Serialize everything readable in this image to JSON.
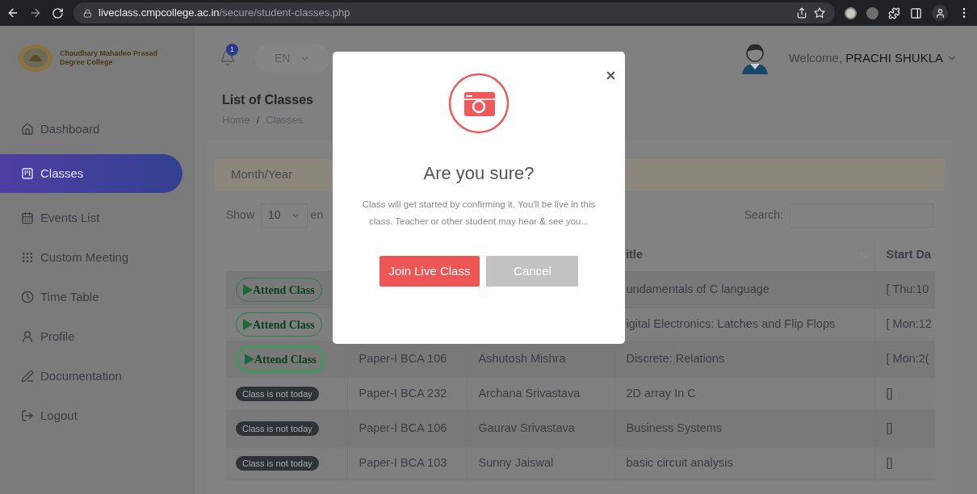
{
  "browser": {
    "url_host": "liveclass.cmpcollege.ac.in",
    "url_path": "/secure/student-classes.php"
  },
  "header": {
    "college_name": "Chaudhary Mahadeo Prasad Degree College",
    "notification_count": "1",
    "language": "EN",
    "welcome": "Welcome,",
    "user_name": "PRACHI SHUKLA"
  },
  "sidebar": {
    "items": [
      {
        "label": "Dashboard",
        "selected": false
      },
      {
        "label": "Classes",
        "selected": true
      },
      {
        "label": "Events List",
        "selected": false
      },
      {
        "label": "Custom Meeting",
        "selected": false
      },
      {
        "label": "Time Table",
        "selected": false
      },
      {
        "label": "Profile",
        "selected": false
      },
      {
        "label": "Documentation",
        "selected": false
      },
      {
        "label": "Logout",
        "selected": false
      }
    ]
  },
  "page": {
    "title": "List of Classes",
    "breadcrumb": [
      "Home",
      "Classes"
    ],
    "breadcrumb_separator": "/",
    "filter_label": "Month/Year",
    "show_label": "Show",
    "page_length": "10",
    "entries_fragment": "en",
    "search_label": "Search:"
  },
  "table": {
    "columns": {
      "title": "itle",
      "start": "Start Da"
    },
    "rows": [
      {
        "action": {
          "kind": "attend",
          "label": "Attend Class",
          "focused": false
        },
        "title": "undamentals of C language",
        "start": "[ Thu:10"
      },
      {
        "action": {
          "kind": "attend",
          "label": "Attend Class",
          "focused": false
        },
        "title": "igital Electronics: Latches and Flip Flops",
        "start": "[ Mon:12"
      },
      {
        "action": {
          "kind": "attend",
          "label": "Attend Class",
          "focused": true
        },
        "subject": "Paper-I BCA 106",
        "teacher": "Ashutosh Mishra",
        "title": "Discrete: Relations",
        "start": "[ Mon:2("
      },
      {
        "action": {
          "kind": "badge",
          "label": "Class is not today"
        },
        "subject": "Paper-I BCA 232",
        "teacher": "Archana Srivastava",
        "title": "2D array In C",
        "start": "[]"
      },
      {
        "action": {
          "kind": "badge",
          "label": "Class is not today"
        },
        "subject": "Paper-I BCA 106",
        "teacher": "Gaurav Srivastava",
        "title": "Business Systems",
        "start": "[]"
      },
      {
        "action": {
          "kind": "badge",
          "label": "Class is not today"
        },
        "subject": "Paper-I BCA 103",
        "teacher": "Sunny Jaiswal",
        "title": "basic circuit analysis",
        "start": "[]"
      }
    ]
  },
  "modal": {
    "title": "Are you sure?",
    "message": "Class will get started by confirming it. You'll be live in this class. Teacher or other student may hear & see you...",
    "confirm": "Join Live Class",
    "cancel": "Cancel"
  }
}
